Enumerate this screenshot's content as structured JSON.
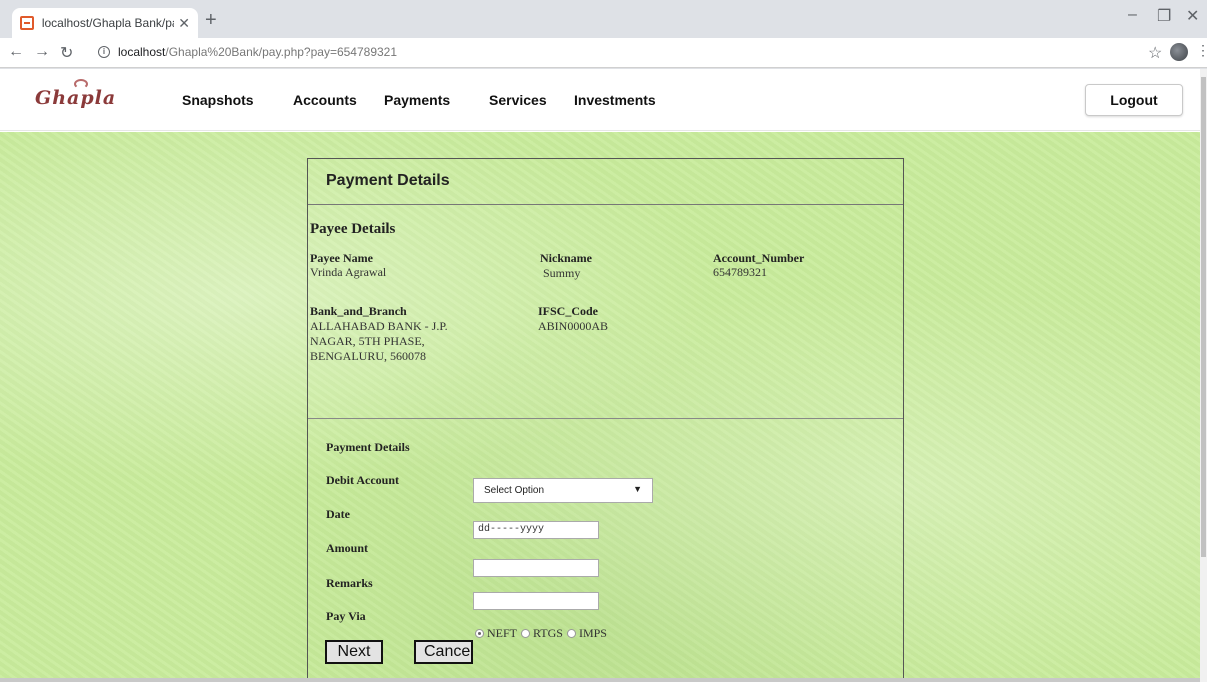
{
  "browser": {
    "tab_title": "localhost/Ghapla Bank/pay.php?p",
    "url_host": "localhost",
    "url_path": "/Ghapla%20Bank/pay.php?pay=654789321"
  },
  "nav": {
    "logo": "Ghapla",
    "items": [
      "Snapshots",
      "Accounts",
      "Payments",
      "Services",
      "Investments"
    ],
    "logout": "Logout"
  },
  "panel": {
    "title": "Payment Details",
    "payee_section": "Payee Details",
    "payee_name_label": "Payee Name",
    "payee_name": "Vrinda Agrawal",
    "nickname_label": "Nickname",
    "nickname": "Summy",
    "account_label": "Account_Number",
    "account": "654789321",
    "bank_label": "Bank_and_Branch",
    "bank_lines": [
      "ALLAHABAD BANK - J.P.",
      "NAGAR, 5TH PHASE,",
      "BENGALURU, 560078"
    ],
    "ifsc_label": "IFSC_Code",
    "ifsc": "ABIN0000AB"
  },
  "form": {
    "title": "Payment Details",
    "debit_label": "Debit Account",
    "debit_value": "Select Option",
    "date_label": "Date",
    "date_value": "dd-----yyyy",
    "amount_label": "Amount",
    "remarks_label": "Remarks",
    "payvia_label": "Pay Via",
    "options": [
      "NEFT",
      "RTGS",
      "IMPS"
    ],
    "selected_option": "NEFT",
    "next": "Next",
    "cancel": "Cancel"
  },
  "colors": {
    "background": "#c9ec9c",
    "logo": "#8b3a3a"
  }
}
